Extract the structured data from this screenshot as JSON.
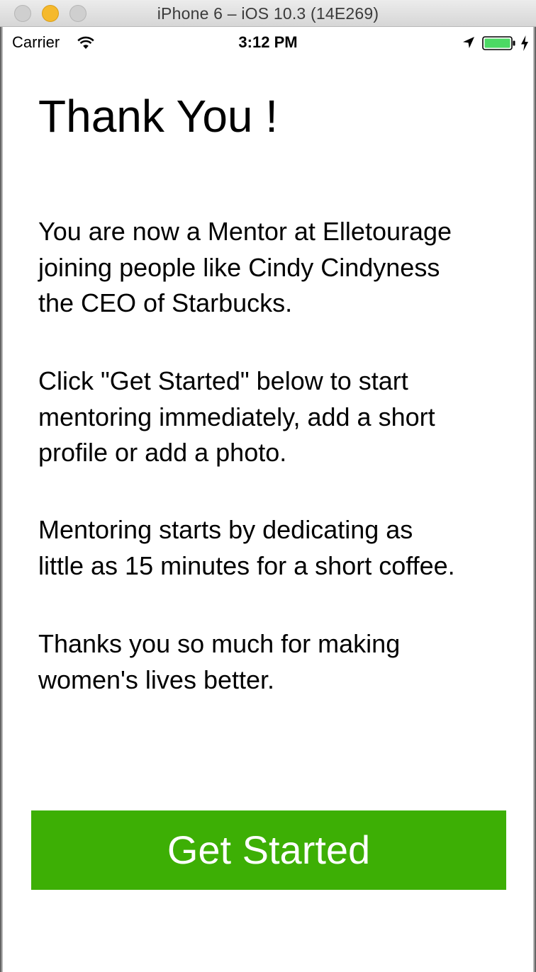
{
  "window": {
    "title": "iPhone 6 – iOS 10.3 (14E269)",
    "controls": [
      "close",
      "minimize",
      "zoom"
    ]
  },
  "status_bar": {
    "carrier": "Carrier",
    "time": "3:12 PM",
    "icons": [
      "wifi-icon",
      "location-icon",
      "battery-icon",
      "charging-icon"
    ],
    "battery_level": 1.0,
    "battery_color": "#4cd964"
  },
  "main": {
    "heading": "Thank You !",
    "paragraphs": [
      "You are now a Mentor at Elletourage\njoining people like Cindy Cindyness\nthe CEO of Starbucks.",
      "Click \"Get Started\" below to start\nmentoring immediately, add a short\nprofile or add a photo.",
      "Mentoring starts by dedicating as\nlittle as 15 minutes for a short coffee.",
      "Thanks you so much for making\nwomen's lives better."
    ],
    "button_label": "Get Started",
    "button_color": "#3daf05"
  }
}
